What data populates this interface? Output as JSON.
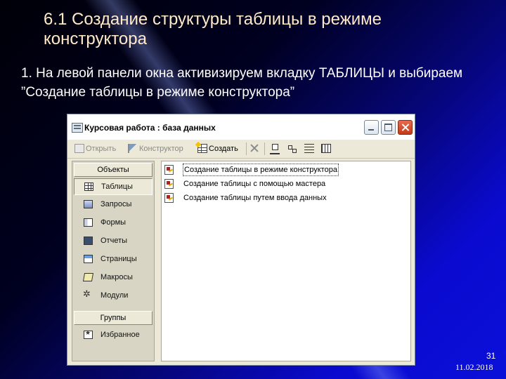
{
  "slide": {
    "title": "6.1 Создание структуры таблицы в режиме конструктора",
    "body": "1. На левой панели окна активизируем вкладку ТАБЛИЦЫ и выбираем ”Создание таблицы в режиме конструктора”",
    "page_number": "31",
    "date": "11.02.2018"
  },
  "window": {
    "title": "Курсовая работа : база данных",
    "controls": {
      "minimize": "minimize",
      "maximize": "maximize",
      "close": "close"
    }
  },
  "toolbar": {
    "open_label": "Открыть",
    "design_label": "Конструктор",
    "create_label": "Создать"
  },
  "sidebar": {
    "objects_header": "Объекты",
    "items": [
      {
        "label": "Таблицы",
        "icon": "table-icon"
      },
      {
        "label": "Запросы",
        "icon": "query-icon"
      },
      {
        "label": "Формы",
        "icon": "form-icon"
      },
      {
        "label": "Отчеты",
        "icon": "report-icon"
      },
      {
        "label": "Страницы",
        "icon": "page-icon"
      },
      {
        "label": "Макросы",
        "icon": "macro-icon"
      },
      {
        "label": "Модули",
        "icon": "module-icon"
      }
    ],
    "groups_header": "Группы",
    "groups": [
      {
        "label": "Избранное",
        "icon": "favorites-icon"
      }
    ]
  },
  "list": {
    "items": [
      "Создание таблицы в режиме конструктора",
      "Создание таблицы с помощью мастера",
      "Создание таблицы путем ввода данных"
    ]
  }
}
